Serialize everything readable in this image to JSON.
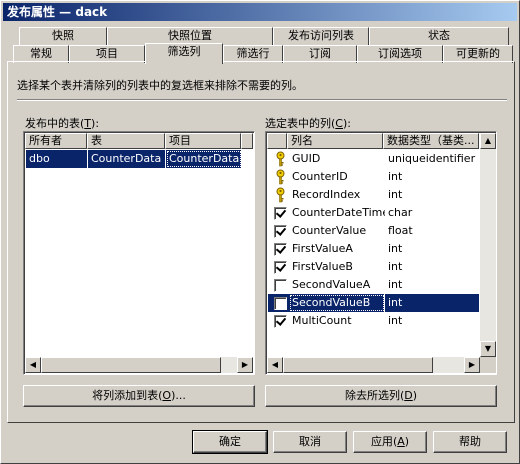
{
  "window": {
    "title": "发布属性 — dack"
  },
  "tabs_back": [
    "快照",
    "快照位置",
    "发布访问列表",
    "状态"
  ],
  "tabs_front": [
    "常规",
    "项目",
    "筛选列",
    "筛选行",
    "订阅",
    "订阅选项",
    "可更新的"
  ],
  "active_tab": "筛选列",
  "description": "选择某个表并清除列的列表中的复选框来排除不需要的列。",
  "left": {
    "label": "发布中的表",
    "accel": "T",
    "headers": [
      "所有者",
      "表",
      "项目"
    ],
    "rows": [
      {
        "owner": "dbo",
        "table": "CounterData",
        "article": "CounterData"
      }
    ],
    "button_label": "将列添加到表",
    "button_accel": "O"
  },
  "right": {
    "label": "选定表中的列",
    "accel": "C",
    "headers": [
      "列名",
      "数据类型（基类..."
    ],
    "rows": [
      {
        "name": "GUID",
        "type": "uniqueidentifier",
        "icon": "key-icon"
      },
      {
        "name": "CounterID",
        "type": "int",
        "icon": "key-icon"
      },
      {
        "name": "RecordIndex",
        "type": "int",
        "icon": "key-icon"
      },
      {
        "name": "CounterDateTime",
        "type": "char",
        "icon": "checkbox-checked"
      },
      {
        "name": "CounterValue",
        "type": "float",
        "icon": "checkbox-checked"
      },
      {
        "name": "FirstValueA",
        "type": "int",
        "icon": "checkbox-checked"
      },
      {
        "name": "FirstValueB",
        "type": "int",
        "icon": "checkbox-checked"
      },
      {
        "name": "SecondValueA",
        "type": "int",
        "icon": "checkbox-unchecked"
      },
      {
        "name": "SecondValueB",
        "type": "int",
        "icon": "checkbox-unchecked"
      },
      {
        "name": "MultiCount",
        "type": "int",
        "icon": "checkbox-checked"
      }
    ],
    "selected_row": "SecondValueB",
    "button_label": "除去所选列",
    "button_accel": "D"
  },
  "footer": {
    "ok": "确定",
    "cancel": "取消",
    "apply": "应用",
    "apply_accel": "A",
    "help": "帮助"
  },
  "colors": {
    "selection": "#0a246a",
    "title_start": "#0a246a",
    "title_end": "#a6caf0",
    "face": "#d4d0c8"
  }
}
